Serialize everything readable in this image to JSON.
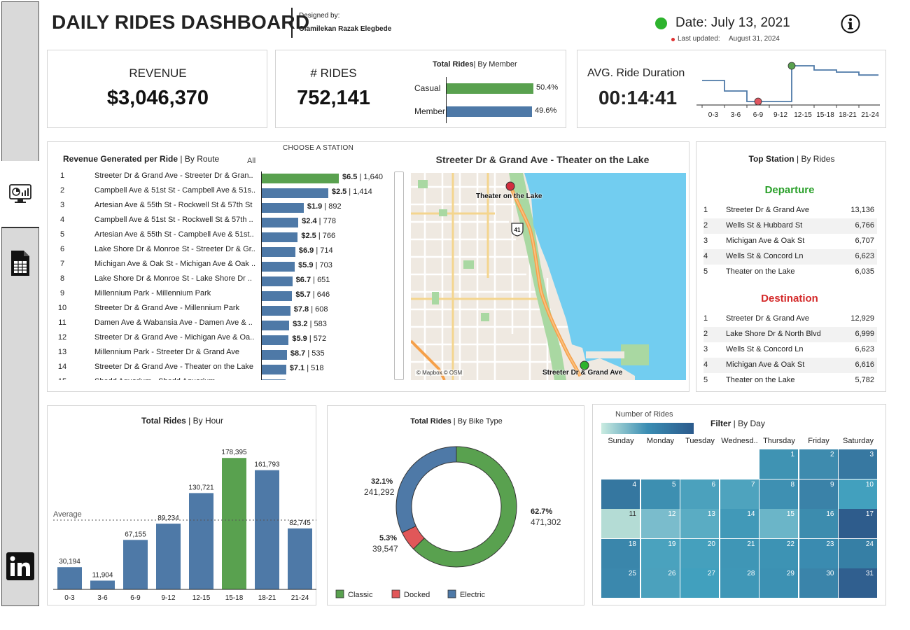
{
  "header": {
    "title": "DAILY RIDES DASHBOARD",
    "designed_by_label": "Designed by:",
    "designer": "Olamilekan Razak Elegbede",
    "date": "Date: July 13, 2021",
    "last_updated_label": "Last updated:",
    "last_updated": "August 31, 2024",
    "info_icon": "info-icon"
  },
  "sidebar": {
    "items": [
      {
        "icon": "dashboard-monitor-icon"
      },
      {
        "icon": "spreadsheet-icon"
      },
      {
        "icon": "linkedin-icon"
      }
    ]
  },
  "kpi": {
    "revenue_label": "REVENUE",
    "revenue_value": "$3,046,370",
    "rides_label": "# RIDES",
    "rides_value": "752,141",
    "member_title": "Total Rides",
    "member_subtitle": "By Member",
    "member_rows": [
      {
        "label": "Casual",
        "pct_text": "50.4%",
        "value": 50.4,
        "color": "#59a14f"
      },
      {
        "label": "Member",
        "pct_text": "49.6%",
        "value": 49.6,
        "color": "#4e79a7"
      }
    ],
    "duration_label": "AVG. Ride Duration",
    "duration_value": "00:14:41",
    "duration_ticks": [
      "0-3",
      "3-6",
      "6-9",
      "9-12",
      "12-15",
      "15-18",
      "18-21",
      "21-24"
    ],
    "duration_levels": [
      0.55,
      0.3,
      0.05,
      0.05,
      0.9,
      0.8,
      0.75,
      0.68
    ],
    "duration_min_index": 2,
    "duration_max_index": 4
  },
  "routes": {
    "title": "Revenue Generated per Ride",
    "subtitle": "By Route",
    "filter_label": "All",
    "station_picker_label": "CHOOSE A STATION",
    "rows": [
      {
        "rank": "1",
        "route": "Streeter Dr & Grand Ave - Streeter Dr & Gran..",
        "avg": "$6.5",
        "rides": "1,640",
        "count": 1640,
        "highlight": true
      },
      {
        "rank": "2",
        "route": "Campbell Ave & 51st St - Campbell Ave & 51s..",
        "avg": "$2.5",
        "rides": "1,414",
        "count": 1414
      },
      {
        "rank": "3",
        "route": "Artesian Ave & 55th St - Rockwell St & 57th St",
        "avg": "$1.9",
        "rides": "892",
        "count": 892
      },
      {
        "rank": "4",
        "route": "Campbell Ave & 51st St - Rockwell St & 57th ..",
        "avg": "$2.4",
        "rides": "778",
        "count": 778
      },
      {
        "rank": "5",
        "route": "Artesian Ave & 55th St - Campbell Ave & 51st..",
        "avg": "$2.5",
        "rides": "766",
        "count": 766
      },
      {
        "rank": "6",
        "route": "Lake Shore Dr & Monroe St - Streeter Dr & Gr..",
        "avg": "$6.9",
        "rides": "714",
        "count": 714
      },
      {
        "rank": "7",
        "route": "Michigan Ave & Oak St - Michigan Ave & Oak ..",
        "avg": "$5.9",
        "rides": "703",
        "count": 703
      },
      {
        "rank": "8",
        "route": "Lake Shore Dr & Monroe St - Lake Shore Dr ..",
        "avg": "$6.7",
        "rides": "651",
        "count": 651
      },
      {
        "rank": "9",
        "route": "Millennium Park - Millennium Park",
        "avg": "$5.7",
        "rides": "646",
        "count": 646
      },
      {
        "rank": "10",
        "route": "Streeter Dr & Grand Ave - Millennium Park",
        "avg": "$7.8",
        "rides": "608",
        "count": 608
      },
      {
        "rank": "11",
        "route": "Damen Ave & Wabansia Ave - Damen Ave & ..",
        "avg": "$3.2",
        "rides": "583",
        "count": 583
      },
      {
        "rank": "12",
        "route": "Streeter Dr & Grand Ave - Michigan Ave & Oa..",
        "avg": "$5.9",
        "rides": "572",
        "count": 572
      },
      {
        "rank": "13",
        "route": "Millennium Park - Streeter Dr & Grand Ave",
        "avg": "$8.7",
        "rides": "535",
        "count": 535
      },
      {
        "rank": "14",
        "route": "Streeter Dr & Grand Ave - Theater on the Lake",
        "avg": "$7.1",
        "rides": "518",
        "count": 518
      },
      {
        "rank": "15",
        "route": "Shedd Aquarium - Shedd Aquarium",
        "avg": "",
        "rides": "",
        "count": 500
      }
    ]
  },
  "map": {
    "title": "Streeter Dr & Grand Ave - Theater on the Lake",
    "start_label": "Theater on the Lake",
    "end_label": "Streeter Dr & Grand Ave",
    "attribution": "© Mapbox © OSM",
    "highway": "41",
    "water_color": "#72cdf0",
    "land_color": "#efe9e1"
  },
  "top_station": {
    "title": "Top Station",
    "subtitle": "By Rides",
    "departure_label": "Departure",
    "departure": [
      {
        "rank": "1",
        "name": "Streeter Dr & Grand Ave",
        "value": "13,136"
      },
      {
        "rank": "2",
        "name": "Wells St & Hubbard St",
        "value": "6,766"
      },
      {
        "rank": "3",
        "name": "Michigan Ave & Oak St",
        "value": "6,707"
      },
      {
        "rank": "4",
        "name": "Wells St & Concord Ln",
        "value": "6,623"
      },
      {
        "rank": "5",
        "name": "Theater on the Lake",
        "value": "6,035"
      }
    ],
    "destination_label": "Destination",
    "destination": [
      {
        "rank": "1",
        "name": "Streeter Dr & Grand Ave",
        "value": "12,929"
      },
      {
        "rank": "2",
        "name": "Lake Shore Dr & North Blvd",
        "value": "6,999"
      },
      {
        "rank": "3",
        "name": "Wells St & Concord Ln",
        "value": "6,623"
      },
      {
        "rank": "4",
        "name": "Michigan Ave & Oak St",
        "value": "6,616"
      },
      {
        "rank": "5",
        "name": "Theater on the Lake",
        "value": "5,782"
      }
    ]
  },
  "hour_chart": {
    "title": "Total Rides",
    "subtitle": "By Hour",
    "average_label": "Average"
  },
  "bike_chart": {
    "title": "Total Rides",
    "subtitle": "By Bike Type"
  },
  "calendar": {
    "legend_label": "Number of Rides",
    "title": "Filter",
    "subtitle": "By Day",
    "days_of_week": [
      "Sunday",
      "Monday",
      "Tuesday",
      "Wednesd..",
      "Thursday",
      "Friday",
      "Saturday"
    ],
    "first_weekday": 4,
    "days": [
      {
        "day": "1",
        "color": "#3f93b3"
      },
      {
        "day": "2",
        "color": "#3e8bae"
      },
      {
        "day": "3",
        "color": "#3778a1"
      },
      {
        "day": "4",
        "color": "#3577a0"
      },
      {
        "day": "5",
        "color": "#3d8fb1"
      },
      {
        "day": "6",
        "color": "#4ba1bd"
      },
      {
        "day": "7",
        "color": "#4ea3be"
      },
      {
        "day": "8",
        "color": "#3e90b2"
      },
      {
        "day": "9",
        "color": "#3a82a8"
      },
      {
        "day": "10",
        "color": "#42a0be"
      },
      {
        "day": "11",
        "color": "#b4dcd5"
      },
      {
        "day": "12",
        "color": "#7abccc"
      },
      {
        "day": "13",
        "color": "#5aacc3"
      },
      {
        "day": "14",
        "color": "#4199b8"
      },
      {
        "day": "15",
        "color": "#6bb5c8"
      },
      {
        "day": "16",
        "color": "#3c8cae"
      },
      {
        "day": "17",
        "color": "#2e5c8c"
      },
      {
        "day": "18",
        "color": "#3a86ab"
      },
      {
        "day": "19",
        "color": "#4aa2be"
      },
      {
        "day": "20",
        "color": "#45a0bd"
      },
      {
        "day": "21",
        "color": "#3f96b6"
      },
      {
        "day": "22",
        "color": "#3d93b4"
      },
      {
        "day": "23",
        "color": "#3a8bb0"
      },
      {
        "day": "24",
        "color": "#367fa5"
      },
      {
        "day": "25",
        "color": "#3b88ad"
      },
      {
        "day": "26",
        "color": "#4ba1bd"
      },
      {
        "day": "27",
        "color": "#41a0be"
      },
      {
        "day": "28",
        "color": "#3f97b7"
      },
      {
        "day": "29",
        "color": "#3c91b3"
      },
      {
        "day": "30",
        "color": "#3a84aa"
      },
      {
        "day": "31",
        "color": "#305f8f"
      }
    ]
  },
  "chart_data": [
    {
      "type": "bar",
      "title": "Total Rides | By Hour",
      "categories": [
        "0-3",
        "3-6",
        "6-9",
        "9-12",
        "12-15",
        "15-18",
        "18-21",
        "21-24"
      ],
      "values": [
        30194,
        11904,
        67155,
        89234,
        130721,
        178395,
        161793,
        82745
      ],
      "labels": [
        "30,194",
        "11,904",
        "67,155",
        "89,234",
        "130,721",
        "178,395",
        "161,793",
        "82,745"
      ],
      "highlight_index": 5,
      "average": 94018,
      "ylim": [
        0,
        190000
      ],
      "colors": {
        "bar": "#4e79a7",
        "highlight": "#59a14f"
      }
    },
    {
      "type": "pie",
      "title": "Total Rides | By Bike Type",
      "slices": [
        {
          "name": "Classic",
          "value": 471302,
          "pct": "62.7%",
          "label": "471,302",
          "color": "#59a14f"
        },
        {
          "name": "Docked",
          "value": 39547,
          "pct": "5.3%",
          "label": "39,547",
          "color": "#e15759"
        },
        {
          "name": "Electric",
          "value": 241292,
          "pct": "32.1%",
          "label": "241,292",
          "color": "#4e79a7"
        }
      ]
    }
  ]
}
